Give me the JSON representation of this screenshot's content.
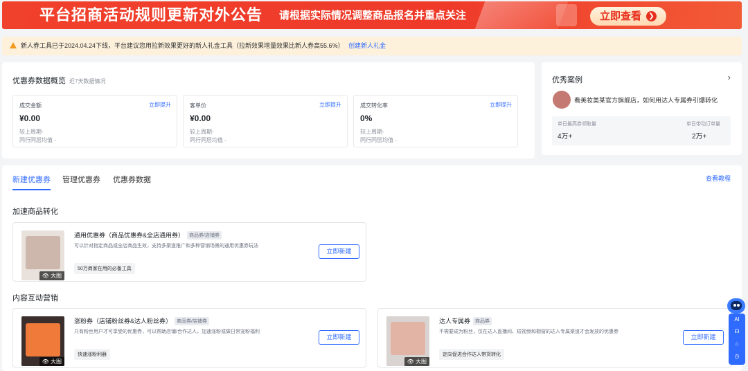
{
  "banner": {
    "title": "平台招商活动规则更新对外公告",
    "subtitle": "请根据实际情况调整商品报名并重点关注",
    "cta": "立即查看"
  },
  "notice": {
    "text": "新人券工具已于2024.04.24下线，平台建议您用拉新效果更好的新人礼金工具（拉新效果增量效果比新人券高55.6%）",
    "link": "创建新人礼金"
  },
  "overview": {
    "title": "优惠券数据概览",
    "hint": "近7天数据情况",
    "stats": [
      {
        "label": "成交金额",
        "action": "立即提升",
        "value": "¥0.00",
        "compare1": "较上周期-",
        "compare2": "同行同层均值 -"
      },
      {
        "label": "客单价",
        "action": "立即提升",
        "value": "¥0.00",
        "compare1": "较上周期-",
        "compare2": "同行同层均值 -"
      },
      {
        "label": "成交转化率",
        "action": "立即提升",
        "value": "0%",
        "compare1": "较上周期-",
        "compare2": "同行同层均值 -"
      }
    ]
  },
  "cases": {
    "title": "优秀案例",
    "case_text": "看美妆类某官方旗舰店，如何用达人专属券引爆转化",
    "metric1_label": "单日最高券领取量",
    "metric1_value": "4万+",
    "metric2_label": "单日带动订单量",
    "metric2_value": "2万+"
  },
  "tabs": [
    "新建优惠券",
    "管理优惠券",
    "优惠券数据"
  ],
  "tutorial": "查看教程",
  "sections": {
    "accelerate": "加速商品转化",
    "content": "内容互动营销"
  },
  "cards": [
    {
      "title": "通用优惠券（商品优惠券&全店通用券）",
      "tag": "商品券/店铺券",
      "desc": "可以针对指定商品或全店商品生效，支持多渠道推广和多种营销场景的通用优惠券玩法",
      "pill": "50万商家在用的必备工具",
      "button": "立即新建",
      "preview": "大图"
    },
    {
      "title": "涨粉券（店铺粉丝券&达人粉丝券）",
      "tag": "商品券/店铺券",
      "desc": "只有粉丝用户才可享受的优惠券，可以帮助店铺/合作达人，加速涨粉或做日常宠粉福利",
      "pill": "快速涨粉利器",
      "button": "立即新建",
      "preview": "大图"
    },
    {
      "title": "达人专属券",
      "tag": "商品券",
      "desc": "不需要成为粉丝，仅在达人直播间、短视频和橱窗的达人专属渠道才会发放的优惠券",
      "pill": "定向促进合作达人带货转化",
      "button": "立即新建",
      "preview": "大图"
    }
  ],
  "toolbar": {
    "ai": "AI"
  }
}
